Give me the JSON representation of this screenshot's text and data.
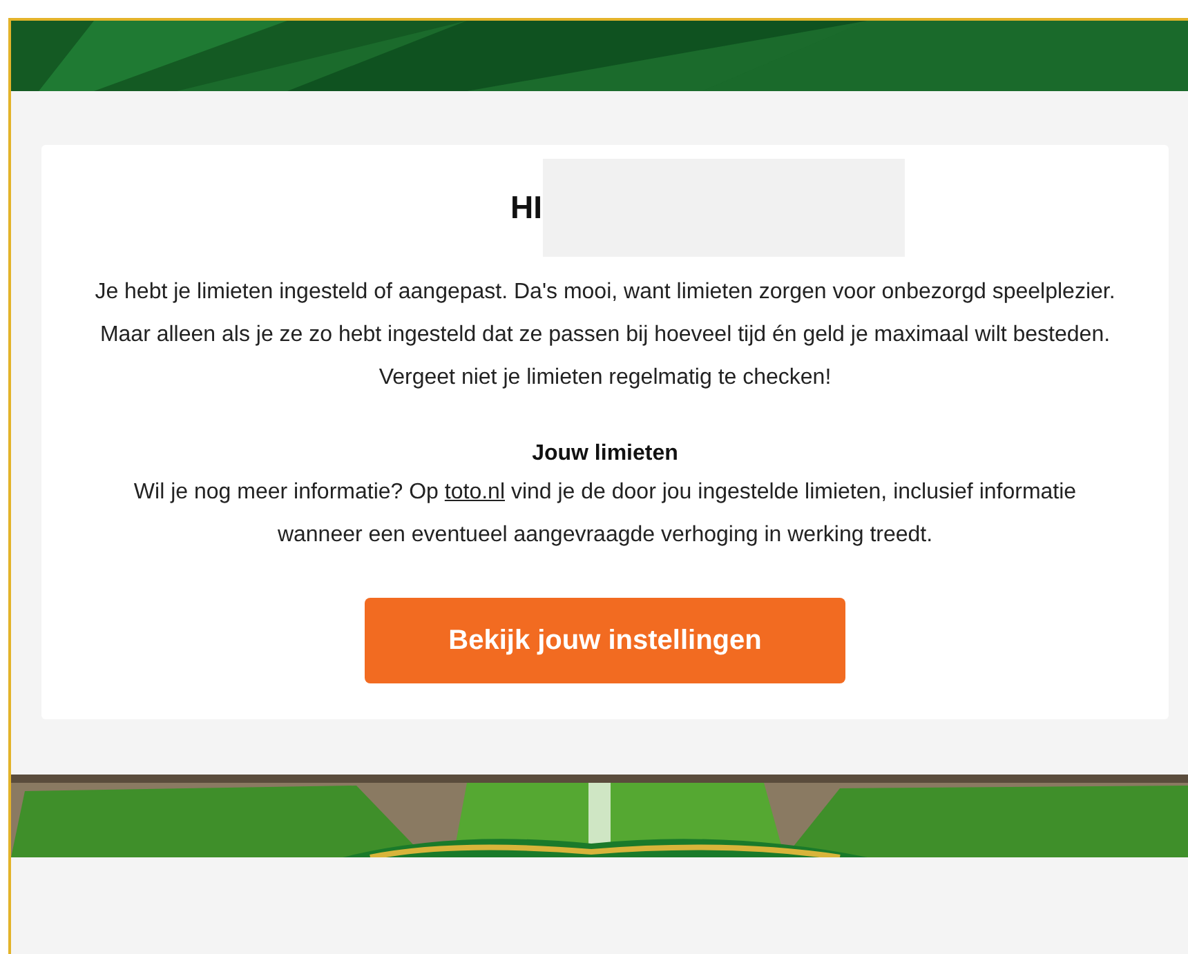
{
  "greeting": "HI",
  "intro": "Je hebt je limieten ingesteld of aangepast. Da's mooi, want limieten zorgen voor onbezorgd speelplezier. Maar alleen als je ze zo hebt ingesteld dat ze passen bij hoeveel tijd én geld je maximaal wilt besteden. Vergeet niet je limieten regelmatig te checken!",
  "section": {
    "title": "Jouw limieten",
    "text_before": "Wil je nog meer informatie? Op ",
    "link": "toto.nl",
    "text_after": " vind je de door jou ingestelde limieten, inclusief informatie wanneer een eventueel aangevraagde verhoging in werking treedt."
  },
  "button": "Bekijk jouw instellingen"
}
